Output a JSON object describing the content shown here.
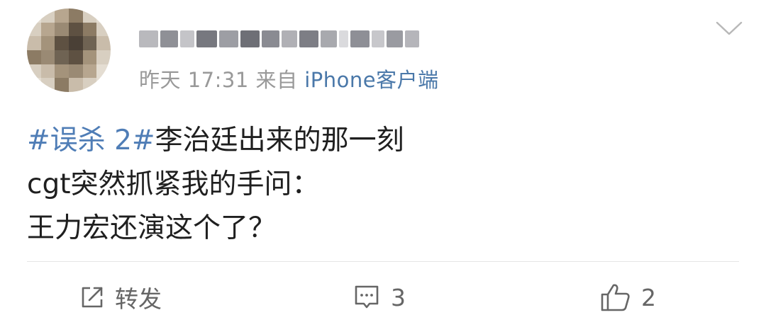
{
  "post": {
    "username": "",
    "meta": {
      "time": "昨天 17:31",
      "source_prefix": "来自",
      "source_name": "iPhone客户端"
    },
    "content": {
      "hashtag": "#误杀 2#",
      "line1_rest": "李治廷出来的那一刻",
      "line2": "cgt突然抓紧我的手问：",
      "line3": "王力宏还演这个了？"
    }
  },
  "actions": {
    "repost_label": "转发",
    "comment_count": "3",
    "like_count": "2"
  },
  "icons": {
    "menu": "chevron-down-icon",
    "repost": "repost-icon",
    "comment": "comment-icon",
    "like": "thumbs-up-icon"
  },
  "colors": {
    "link": "#4f7db6",
    "meta_gray": "#999999",
    "icon_gray": "#666666"
  }
}
